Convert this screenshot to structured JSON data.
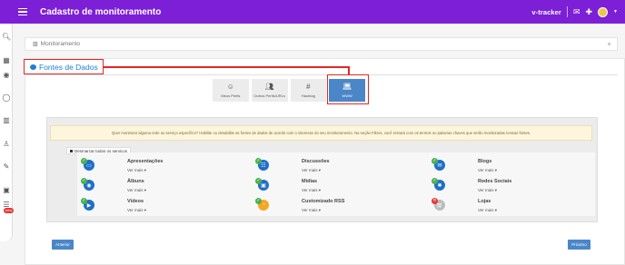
{
  "header": {
    "title": "Cadastro de monitoramento",
    "brand": "v-tracker"
  },
  "monitoramento": {
    "title": "Monitoramento"
  },
  "tab": {
    "label": "Fontes de Dados"
  },
  "sources": [
    {
      "label": "Meus Perfis",
      "icon": "user-circle-icon",
      "active": false
    },
    {
      "label": "Outros Perfis/URLs",
      "icon": "users-icon",
      "active": false
    },
    {
      "label": "Hashtag",
      "icon": "hashtag-icon",
      "active": false
    },
    {
      "label": "WWW",
      "icon": "laptop-icon",
      "active": true
    }
  ],
  "notice": "Quer monitorar alguma rede ou serviço específico? Habilite ou desabilite as fontes de dados de acordo com o interesse do seu monitoramento. Na seção Filtros, você entrará com os termos ou palavras chaves que serão monitoradas nessas fontes.",
  "deselect_label": "Desmarcar todos os serviços",
  "see_more": "Ver mais",
  "services": [
    {
      "name": "Apresentações",
      "icon": "presentation-icon",
      "color": "#1e6fc9",
      "enabled": true
    },
    {
      "name": "Discussões",
      "icon": "discussion-icon",
      "color": "#1e6fc9",
      "enabled": true
    },
    {
      "name": "Blogs",
      "icon": "blog-icon",
      "color": "#1e6fc9",
      "enabled": true
    },
    {
      "name": "Álbuns",
      "icon": "camera-icon",
      "color": "#1e6fc9",
      "enabled": true
    },
    {
      "name": "Mídias",
      "icon": "media-icon",
      "color": "#1e6fc9",
      "enabled": true
    },
    {
      "name": "Redes Sociais",
      "icon": "social-network-icon",
      "color": "#1e6fc9",
      "enabled": true
    },
    {
      "name": "Vídeos",
      "icon": "play-icon",
      "color": "#1e6fc9",
      "enabled": true
    },
    {
      "name": "Customizado RSS",
      "icon": "rss-icon",
      "color": "#f5a623",
      "enabled": true
    },
    {
      "name": "Lojas",
      "icon": "cart-icon",
      "color": "#bbbbbb",
      "enabled": false
    }
  ],
  "buttons": {
    "back": "Anterior",
    "next": "Próximo"
  },
  "rail": {
    "new_badge": "new"
  },
  "colors": {
    "header": "#7c1fd6",
    "accent": "#1e7fd4",
    "highlight": "#e32626"
  }
}
